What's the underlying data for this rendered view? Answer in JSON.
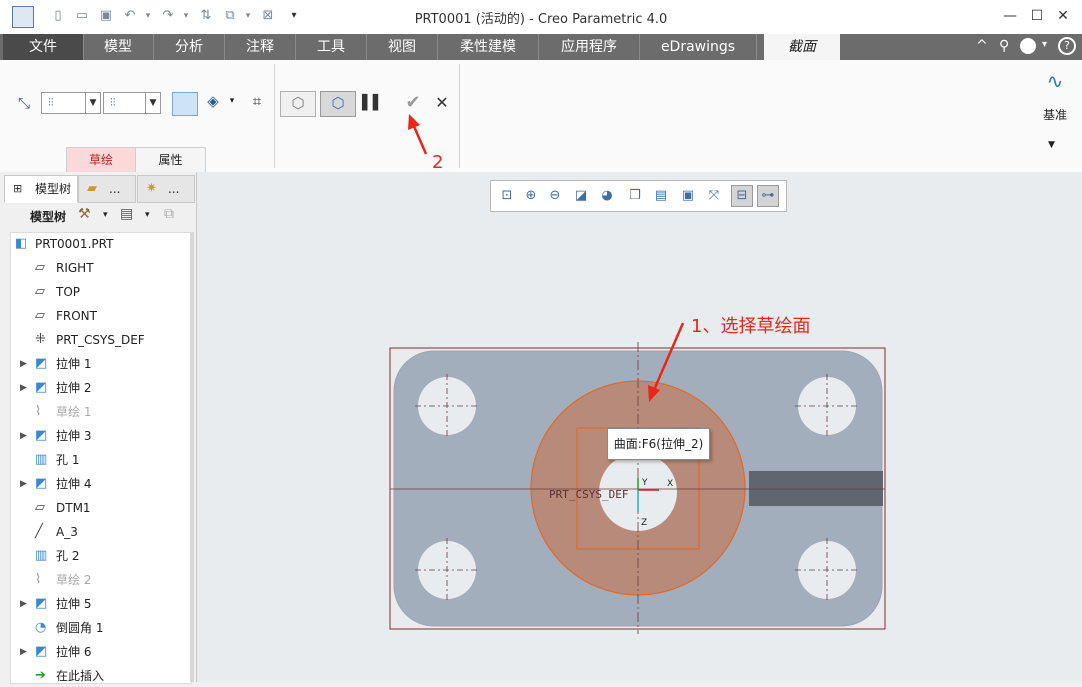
{
  "window": {
    "title": "PRT0001 (活动的) - Creo Parametric 4.0",
    "minimize": "—",
    "maximize": "☐",
    "close": "✕"
  },
  "tabs": [
    {
      "label": "文件"
    },
    {
      "label": "模型"
    },
    {
      "label": "分析"
    },
    {
      "label": "注释"
    },
    {
      "label": "工具"
    },
    {
      "label": "视图"
    },
    {
      "label": "柔性建模"
    },
    {
      "label": "应用程序"
    },
    {
      "label": "eDrawings"
    },
    {
      "label": "截面"
    }
  ],
  "ribbon": {
    "subtabs": [
      {
        "label": "草绘"
      },
      {
        "label": "属性"
      }
    ],
    "datum_label": "基准",
    "pause_icon": "pause-icon",
    "ok_icon": "check-icon",
    "cancel_icon": "close-icon"
  },
  "panel": {
    "tabs": [
      {
        "label": "模型树"
      },
      {
        "label": "..."
      },
      {
        "label": "..."
      }
    ],
    "toolbar_label": "模型树",
    "tree": [
      {
        "label": "PRT0001.PRT",
        "icon": "part-icon",
        "expand": "",
        "dim": false
      },
      {
        "label": "RIGHT",
        "icon": "datum-plane-icon",
        "expand": "",
        "dim": false
      },
      {
        "label": "TOP",
        "icon": "datum-plane-icon",
        "expand": "",
        "dim": false
      },
      {
        "label": "FRONT",
        "icon": "datum-plane-icon",
        "expand": "",
        "dim": false
      },
      {
        "label": "PRT_CSYS_DEF",
        "icon": "csys-icon",
        "expand": "",
        "dim": false
      },
      {
        "label": "拉伸 1",
        "icon": "extrude-icon",
        "expand": "▶",
        "dim": false
      },
      {
        "label": "拉伸 2",
        "icon": "extrude-icon",
        "expand": "▶",
        "dim": false
      },
      {
        "label": "草绘 1",
        "icon": "sketch-icon",
        "expand": "",
        "dim": true
      },
      {
        "label": "拉伸 3",
        "icon": "extrude-icon",
        "expand": "▶",
        "dim": false
      },
      {
        "label": "孔 1",
        "icon": "hole-icon",
        "expand": "",
        "dim": false
      },
      {
        "label": "拉伸 4",
        "icon": "extrude-icon",
        "expand": "▶",
        "dim": false
      },
      {
        "label": "DTM1",
        "icon": "datum-plane-icon",
        "expand": "",
        "dim": false
      },
      {
        "label": "A_3",
        "icon": "axis-icon",
        "expand": "",
        "dim": false
      },
      {
        "label": "孔 2",
        "icon": "hole-icon",
        "expand": "",
        "dim": false
      },
      {
        "label": "草绘 2",
        "icon": "sketch-icon",
        "expand": "",
        "dim": true
      },
      {
        "label": "拉伸 5",
        "icon": "extrude-icon",
        "expand": "▶",
        "dim": false
      },
      {
        "label": "倒圆角 1",
        "icon": "round-icon",
        "expand": "",
        "dim": false
      },
      {
        "label": "拉伸 6",
        "icon": "extrude-icon",
        "expand": "▶",
        "dim": false
      },
      {
        "label": "在此插入",
        "icon": "insert-arrow-icon",
        "expand": "",
        "dim": false
      }
    ]
  },
  "graphics": {
    "tooltip": "曲面:F6(拉伸_2)",
    "csys_label": "PRT_CSYS_DEF",
    "axis_x": "X",
    "axis_y": "Y",
    "axis_z": "Z",
    "annotation_1": "1、选择草绘面",
    "annotation_2": "2"
  },
  "colors": {
    "part_fill": "#a2aebb",
    "highlight_fill": "#b88a7a",
    "highlight_stroke": "#e06a2a",
    "annotation": "#e8261c"
  }
}
